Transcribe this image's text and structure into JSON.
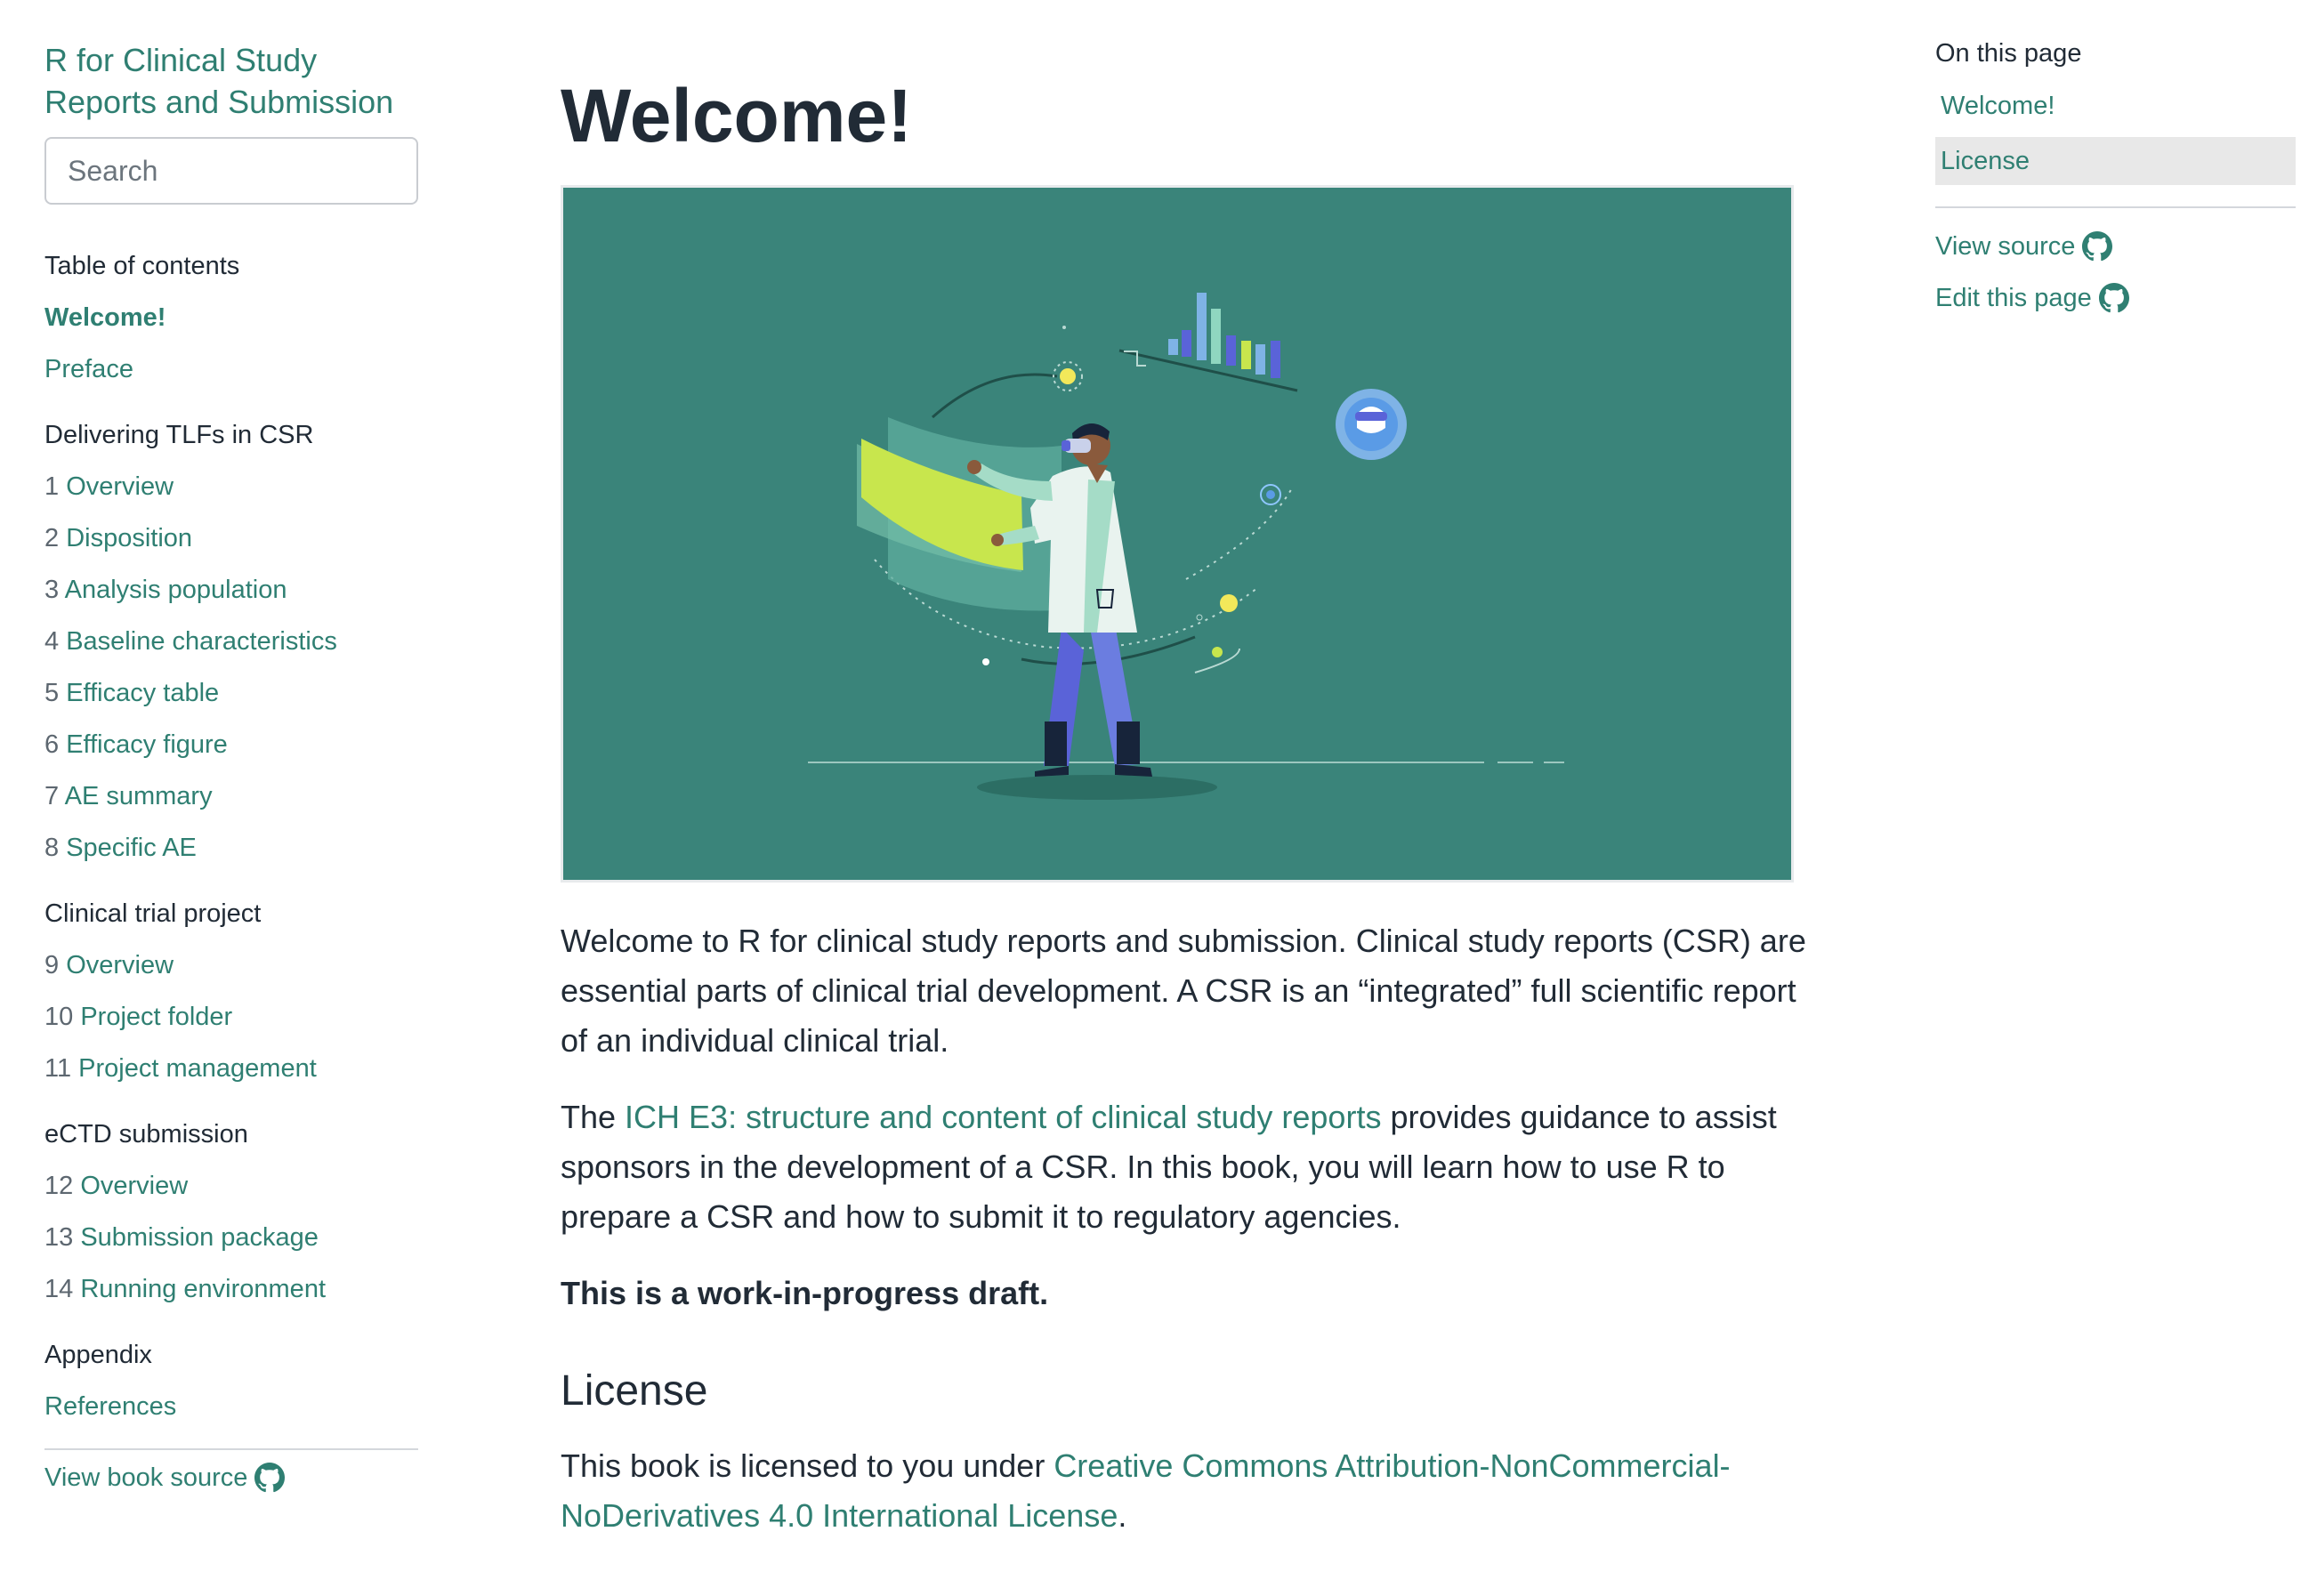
{
  "sidebar": {
    "book_title": "R for Clinical Study Reports and Submission",
    "search_placeholder": "Search",
    "toc_heading": "Table of contents",
    "welcome": "Welcome!",
    "preface": "Preface",
    "part1": {
      "title": "Delivering TLFs in CSR",
      "items": [
        {
          "num": "1",
          "label": "Overview"
        },
        {
          "num": "2",
          "label": "Disposition"
        },
        {
          "num": "3",
          "label": "Analysis population"
        },
        {
          "num": "4",
          "label": "Baseline characteristics"
        },
        {
          "num": "5",
          "label": "Efficacy table"
        },
        {
          "num": "6",
          "label": "Efficacy figure"
        },
        {
          "num": "7",
          "label": "AE summary"
        },
        {
          "num": "8",
          "label": "Specific AE"
        }
      ]
    },
    "part2": {
      "title": "Clinical trial project",
      "items": [
        {
          "num": "9",
          "label": "Overview"
        },
        {
          "num": "10",
          "label": "Project folder"
        },
        {
          "num": "11",
          "label": "Project management"
        }
      ]
    },
    "part3": {
      "title": "eCTD submission",
      "items": [
        {
          "num": "12",
          "label": "Overview"
        },
        {
          "num": "13",
          "label": "Submission package"
        },
        {
          "num": "14",
          "label": "Running environment"
        }
      ]
    },
    "appendix": {
      "title": "Appendix",
      "references": "References"
    },
    "view_book_source": "View book source"
  },
  "main": {
    "title": "Welcome!",
    "intro": "Welcome to R for clinical study reports and submission. Clinical study reports (CSR) are essential parts of clinical trial development. A CSR is an “integrated” full scientific report of an individual clinical trial.",
    "p2_before": "The ",
    "p2_link": "ICH E3: structure and content of clinical study reports",
    "p2_after": " provides guidance to assist sponsors in the development of a CSR. In this book, you will learn how to use R to prepare a CSR and how to submit it to regulatory agencies.",
    "draft_note": "This is a work-in-progress draft.",
    "license_heading": "License",
    "license_before": "This book is licensed to you under ",
    "license_link": "Creative Commons Attribution-NonCommercial-NoDerivatives 4.0 International License",
    "license_after": "."
  },
  "right_toc": {
    "title": "On this page",
    "items": [
      "Welcome!",
      "License"
    ],
    "view_source": "View source",
    "edit_page": "Edit this page"
  },
  "colors": {
    "accent": "#2f7f72",
    "hero_bg": "#3a847a",
    "lime": "#c8e64d",
    "bar_blue": "#5a63d8",
    "bar_light": "#7fb3e6"
  }
}
